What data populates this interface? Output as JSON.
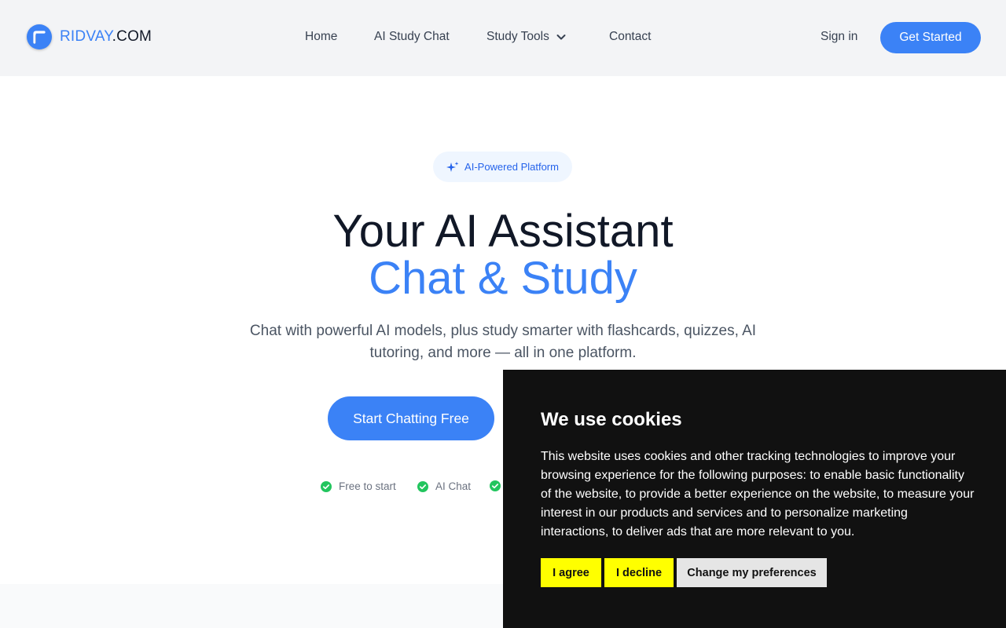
{
  "header": {
    "logo": {
      "brand": "RIDVAY",
      "tld": ".COM"
    },
    "nav": [
      {
        "label": "Home"
      },
      {
        "label": "AI Study Chat"
      },
      {
        "label": "Study Tools"
      },
      {
        "label": "Contact"
      }
    ],
    "signin_label": "Sign in",
    "cta_label": "Get Started"
  },
  "hero": {
    "badge": "AI-Powered Platform",
    "title_line1": "Your AI Assistant",
    "title_line2": "Chat & Study",
    "subtitle": "Chat with powerful AI models, plus study smarter with flashcards, quizzes, AI tutoring, and more — all in one platform.",
    "cta_label": "Start Chatting Free",
    "features": [
      "Free to start",
      "AI Chat"
    ]
  },
  "cookie_banner": {
    "title": "We use cookies",
    "body": "This website uses cookies and other tracking technologies to improve your browsing experience for the following purposes: to enable basic functionality of the website, to provide a better experience on the website, to measure your interest in our products and services and to personalize marketing interactions, to deliver ads that are more relevant to you.",
    "agree_label": "I agree",
    "decline_label": "I decline",
    "prefs_label": "Change my preferences"
  },
  "colors": {
    "accent": "#3b82f6",
    "header_bg": "#f3f4f6",
    "check": "#22c55e",
    "cookie_bg": "#111111",
    "cookie_button": "#ffff00"
  },
  "icons": {
    "logo": "logo-mark-icon",
    "dropdown": "chevron-down-icon",
    "badge": "sparkles-icon",
    "feature": "check-circle-icon"
  }
}
